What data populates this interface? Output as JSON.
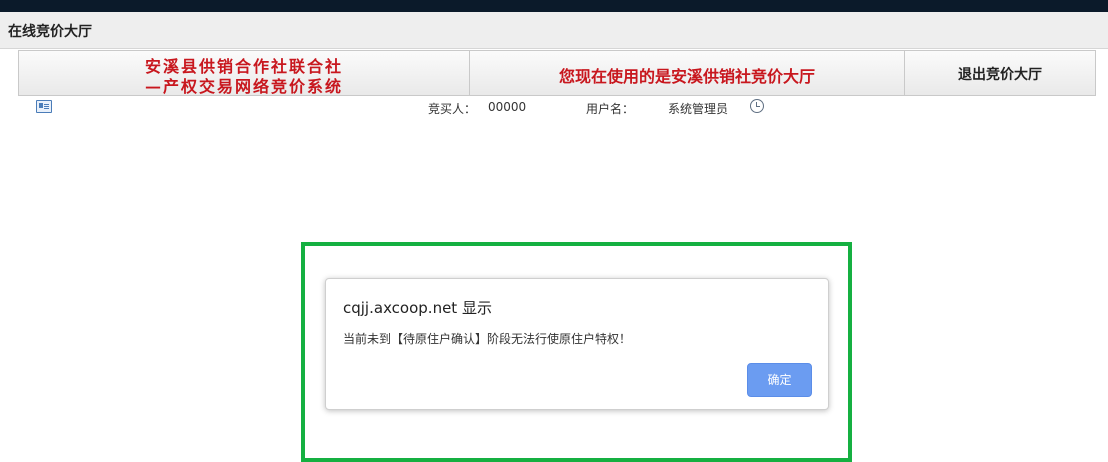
{
  "window": {
    "app_title": "在线竞价大厅"
  },
  "header": {
    "org_name_line1": "安溪县供销合作社联合社",
    "org_name_line2": "—产权交易网络竞价系统",
    "notice": "您现在使用的是安溪供销社竞价大厅",
    "exit_label": "退出竞价大厅"
  },
  "info": {
    "buyer_label": "竞买人：",
    "buyer_value": "00000",
    "user_label": "用户名：",
    "user_value": "系统管理员"
  },
  "dialog": {
    "title": "cqjj.axcoop.net 显示",
    "message": "当前未到【待原住户确认】阶段无法行使原住户特权！",
    "ok_label": "确定"
  },
  "icons": {
    "card": "id-card-icon",
    "clock": "clock-icon"
  },
  "colors": {
    "brand_red": "#c8171e",
    "highlight_green": "#15b041",
    "button_blue": "#6b9cf1",
    "top_bar": "#0b1a2a"
  }
}
